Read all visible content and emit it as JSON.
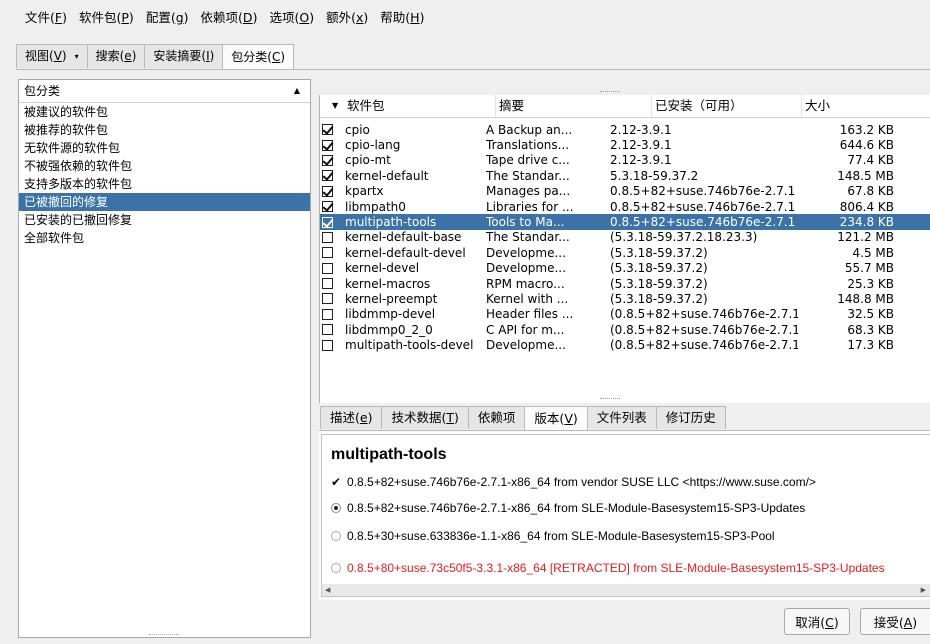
{
  "menubar": [
    {
      "text": "文件(",
      "key": "F",
      "end": ")"
    },
    {
      "text": "软件包(",
      "key": "P",
      "end": ")"
    },
    {
      "text": "配置(",
      "key": "g",
      "end": ")"
    },
    {
      "text": "依赖项(",
      "key": "D",
      "end": ")"
    },
    {
      "text": "选项(",
      "key": "O",
      "end": ")"
    },
    {
      "text": "额外(",
      "key": "x",
      "end": ")"
    },
    {
      "text": "帮助(",
      "key": "H",
      "end": ")"
    }
  ],
  "top_tabs": [
    {
      "text": "视图(",
      "key": "V",
      "end": ")"
    },
    {
      "text": "搜索(",
      "key": "e",
      "end": ")"
    },
    {
      "text": "安装摘要(",
      "key": "I",
      "end": ")"
    },
    {
      "text": "包分类(",
      "key": "C",
      "end": ")"
    }
  ],
  "left_panel": {
    "header": "包分类",
    "items": [
      "被建议的软件包",
      "被推荐的软件包",
      "无软件源的软件包",
      "不被强依赖的软件包",
      "支持多版本的软件包",
      "已被撤回的修复",
      "已安装的已撤回修复",
      "全部软件包"
    ],
    "selected_index": 5
  },
  "package_table": {
    "headers": {
      "name": "软件包",
      "summary": "摘要",
      "installed": "已安装（可用）",
      "size": "大小"
    },
    "rows": [
      {
        "checked": true,
        "name": "cpio",
        "summary": "A Backup an...",
        "installed": "2.12-3.9.1",
        "size": "163.2 KB"
      },
      {
        "checked": true,
        "name": "cpio-lang",
        "summary": "Translations...",
        "installed": "2.12-3.9.1",
        "size": "644.6 KB"
      },
      {
        "checked": true,
        "name": "cpio-mt",
        "summary": "Tape drive c...",
        "installed": "2.12-3.9.1",
        "size": "77.4 KB"
      },
      {
        "checked": true,
        "name": "kernel-default",
        "summary": "The Standar...",
        "installed": "5.3.18-59.37.2",
        "size": "148.5 MB"
      },
      {
        "checked": true,
        "name": "kpartx",
        "summary": "Manages pa...",
        "installed": "0.8.5+82+suse.746b76e-2.7.1",
        "size": "67.8 KB"
      },
      {
        "checked": true,
        "name": "libmpath0",
        "summary": "Libraries for ...",
        "installed": "0.8.5+82+suse.746b76e-2.7.1",
        "size": "806.4 KB"
      },
      {
        "checked": true,
        "name": "multipath-tools",
        "summary": "Tools to Ma...",
        "installed": "0.8.5+82+suse.746b76e-2.7.1",
        "size": "234.8 KB"
      },
      {
        "checked": false,
        "name": "kernel-default-base",
        "summary": "The Standar...",
        "installed": "(5.3.18-59.37.2.18.23.3)",
        "size": "121.2 MB"
      },
      {
        "checked": false,
        "name": "kernel-default-devel",
        "summary": "Developme...",
        "installed": "(5.3.18-59.37.2)",
        "size": "4.5 MB"
      },
      {
        "checked": false,
        "name": "kernel-devel",
        "summary": "Developme...",
        "installed": "(5.3.18-59.37.2)",
        "size": "55.7 MB"
      },
      {
        "checked": false,
        "name": "kernel-macros",
        "summary": "RPM macro...",
        "installed": "(5.3.18-59.37.2)",
        "size": "25.3 KB"
      },
      {
        "checked": false,
        "name": "kernel-preempt",
        "summary": "Kernel with ...",
        "installed": "(5.3.18-59.37.2)",
        "size": "148.8 MB"
      },
      {
        "checked": false,
        "name": "libdmmp-devel",
        "summary": "Header files ...",
        "installed": "(0.8.5+82+suse.746b76e-2.7.1)",
        "size": "32.5 KB"
      },
      {
        "checked": false,
        "name": "libdmmp0_2_0",
        "summary": "C API for m...",
        "installed": "(0.8.5+82+suse.746b76e-2.7.1)",
        "size": "68.3 KB"
      },
      {
        "checked": false,
        "name": "multipath-tools-devel",
        "summary": "Developme...",
        "installed": "(0.8.5+82+suse.746b76e-2.7.1)",
        "size": "17.3 KB"
      }
    ],
    "selected_index": 6
  },
  "detail_tabs": [
    {
      "text": "描述(",
      "key": "e",
      "end": ")"
    },
    {
      "text": "技术数据(",
      "key": "T",
      "end": ")"
    },
    {
      "text": "依赖项",
      "key": "",
      "end": ""
    },
    {
      "text": "版本(",
      "key": "V",
      "end": ")"
    },
    {
      "text": "文件列表",
      "key": "",
      "end": ""
    },
    {
      "text": "修订历史",
      "key": "",
      "end": ""
    }
  ],
  "detail": {
    "title": "multipath-tools",
    "installed_line": "0.8.5+82+suse.746b76e-2.7.1-x86_64 from vendor SUSE LLC <https://www.suse.com/>",
    "versions": [
      {
        "text": "0.8.5+82+suse.746b76e-2.7.1-x86_64 from SLE-Module-Basesystem15-SP3-Updates",
        "selected": true,
        "retracted": false
      },
      {
        "text": "0.8.5+30+suse.633836e-1.1-x86_64 from SLE-Module-Basesystem15-SP3-Pool",
        "selected": false,
        "retracted": false
      },
      {
        "text": "0.8.5+80+suse.73c50f5-3.3.1-x86_64 [RETRACTED] from SLE-Module-Basesystem15-SP3-Updates",
        "selected": false,
        "retracted": true
      }
    ]
  },
  "buttons": {
    "cancel": {
      "text": "取消(",
      "key": "C",
      "end": ")"
    },
    "accept": {
      "text": "接受(",
      "key": "A",
      "end": ")"
    }
  },
  "colors": {
    "selection": "#3b73a8",
    "retracted_text": "#e0201e"
  }
}
